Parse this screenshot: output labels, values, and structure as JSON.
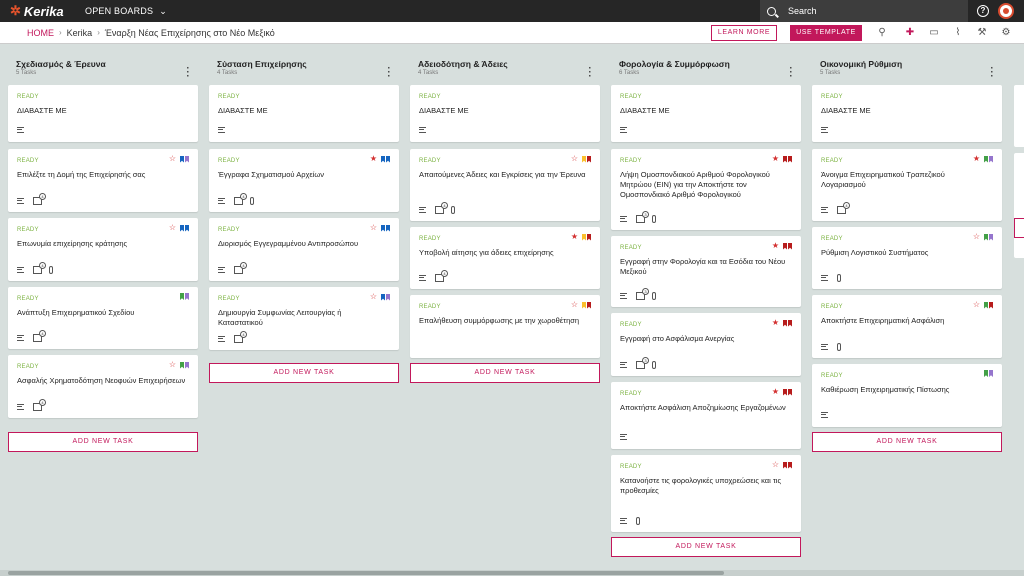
{
  "app": {
    "name": "Kerika",
    "open_boards": "OPEN BOARDS"
  },
  "search": {
    "placeholder": "Search"
  },
  "breadcrumb": {
    "home": "HOME",
    "org": "Kerika",
    "board": "Έναρξη Νέας Επιχείρησης στο Νέο Μεξικό"
  },
  "buttons": {
    "learn_more": "LEARN MORE",
    "use_template": "USE TEMPLATE",
    "add_task": "ADD NEW TASK"
  },
  "colors": {
    "accent": "#c2185b",
    "ready": "#7cb342",
    "star_red": "#d32f2f",
    "flag_blue": "#1565c0",
    "flag_purple": "#9575cd",
    "flag_green": "#43a047",
    "flag_yellow": "#fbc02d",
    "flag_darkred": "#b71c1c"
  },
  "columns": [
    {
      "title": "Σχεδιασμός & Έρευνα",
      "count": "5 Tasks",
      "cards": [
        {
          "status": "READY",
          "title": "ΔΙΑΒΑΣΤΕ ΜΕ",
          "flags": [],
          "icons": [
            "lines"
          ]
        },
        {
          "status": "READY",
          "title": "Επιλέξτε τη Δομή της Επιχείρησής σας",
          "star": "outline",
          "flags": [
            "blue",
            "purple"
          ],
          "icons": [
            "lines",
            "check"
          ],
          "checks": "4"
        },
        {
          "status": "READY",
          "title": "Επωνυμία επιχείρησης κράτησης",
          "star": "outline",
          "flags": [
            "blue",
            "blue"
          ],
          "icons": [
            "lines",
            "check",
            "clip"
          ],
          "checks": "4"
        },
        {
          "status": "READY",
          "title": "Ανάπτυξη Επιχειρηματικού Σχεδίου",
          "flags": [
            "green",
            "purple"
          ],
          "icons": [
            "lines",
            "check"
          ],
          "checks": "4"
        },
        {
          "status": "READY",
          "title": "Ασφαλής Χρηματοδότηση Νεοφυών Επιχειρήσεων",
          "star": "outline",
          "flags": [
            "green",
            "purple"
          ],
          "icons": [
            "lines",
            "check"
          ],
          "checks": "4"
        }
      ]
    },
    {
      "title": "Σύσταση Επιχείρησης",
      "count": "4 Tasks",
      "cards": [
        {
          "status": "READY",
          "title": "ΔΙΑΒΑΣΤΕ ΜΕ",
          "flags": [],
          "icons": [
            "lines"
          ]
        },
        {
          "status": "READY",
          "title": "Έγγραφα Σχηματισμού Αρχείων",
          "star": "filled",
          "flags": [
            "blue",
            "blue"
          ],
          "icons": [
            "lines",
            "check",
            "clip"
          ],
          "checks": "4"
        },
        {
          "status": "READY",
          "title": "Διορισμός Εγγεγραμμένου Αντιπροσώπου",
          "star": "outline",
          "flags": [
            "blue",
            "blue"
          ],
          "icons": [
            "lines",
            "check"
          ],
          "checks": "4"
        },
        {
          "status": "READY",
          "title": "Δημιουργία Συμφωνίας Λειτουργίας ή Καταστατικού",
          "star": "outline",
          "flags": [
            "blue",
            "purple"
          ],
          "icons": [
            "lines",
            "check"
          ],
          "checks": "4"
        }
      ]
    },
    {
      "title": "Αδειοδότηση & Άδειες",
      "count": "4 Tasks",
      "cards": [
        {
          "status": "READY",
          "title": "ΔΙΑΒΑΣΤΕ ΜΕ",
          "flags": [],
          "icons": [
            "lines"
          ]
        },
        {
          "status": "READY",
          "title": "Απαιτούμενες Άδειες και Εγκρίσεις για την Έρευνα",
          "star": "outline",
          "flags": [
            "yellow",
            "darkred"
          ],
          "icons": [
            "lines",
            "check",
            "clip"
          ],
          "checks": "4"
        },
        {
          "status": "READY",
          "title": "Υποβολή αίτησης για άδειες επιχείρησης",
          "star": "filled",
          "flags": [
            "yellow",
            "darkred"
          ],
          "icons": [
            "lines",
            "check"
          ],
          "checks": "4"
        },
        {
          "status": "READY",
          "title": "Επαλήθευση συμμόρφωσης με την χωροθέτηση",
          "star": "outline",
          "flags": [
            "yellow",
            "darkred"
          ],
          "icons": []
        }
      ]
    },
    {
      "title": "Φορολογία & Συμμόρφωση",
      "count": "6 Tasks",
      "cards": [
        {
          "status": "READY",
          "title": "ΔΙΑΒΑΣΤΕ ΜΕ",
          "flags": [],
          "icons": [
            "lines"
          ]
        },
        {
          "status": "READY",
          "title": "Λήψη Ομοσπονδιακού Αριθμού Φορολογικού Μητρώου (EIN) για την Αποκτήστε τον Ομοσπονδιακό Αριθμό Φορολογικού",
          "star": "filled",
          "flags": [
            "darkred",
            "darkred"
          ],
          "icons": [
            "lines",
            "check",
            "clip"
          ],
          "checks": "3"
        },
        {
          "status": "READY",
          "title": "Εγγραφή στην Φορολογία και τα Εσόδια του Νέου Μεξικού",
          "star": "filled",
          "flags": [
            "darkred",
            "darkred"
          ],
          "icons": [
            "lines",
            "check",
            "clip"
          ],
          "checks": "3"
        },
        {
          "status": "READY",
          "title": "Εγγραφή στο Ασφάλισμα Ανεργίας",
          "star": "filled",
          "flags": [
            "darkred",
            "darkred"
          ],
          "icons": [
            "lines",
            "check",
            "clip"
          ],
          "checks": "3"
        },
        {
          "status": "READY",
          "title": "Αποκτήστε Ασφάλιση Αποζημίωσης Εργαζομένων",
          "star": "filled",
          "flags": [
            "darkred",
            "darkred"
          ],
          "icons": [
            "lines"
          ]
        },
        {
          "status": "READY",
          "title": "Κατανοήστε τις φορολογικές υποχρεώσεις και τις προθεσμίες",
          "star": "outline",
          "flags": [
            "darkred",
            "darkred"
          ],
          "icons": [
            "lines",
            "clip"
          ]
        }
      ]
    },
    {
      "title": "Οικονομική Ρύθμιση",
      "count": "5 Tasks",
      "cards": [
        {
          "status": "READY",
          "title": "ΔΙΑΒΑΣΤΕ ΜΕ",
          "flags": [],
          "icons": [
            "lines"
          ]
        },
        {
          "status": "READY",
          "title": "Άνοιγμα Επιχειρηματικού Τραπεζικού Λογαριασμού",
          "star": "filled",
          "flags": [
            "green",
            "purple"
          ],
          "icons": [
            "lines",
            "check"
          ],
          "checks": "4"
        },
        {
          "status": "READY",
          "title": "Ρύθμιση Λογιστικού Συστήματος",
          "star": "outline",
          "flags": [
            "green",
            "purple"
          ],
          "icons": [
            "lines",
            "clip"
          ]
        },
        {
          "status": "READY",
          "title": "Αποκτήστε Επιχειρηματική Ασφάλιση",
          "star": "outline",
          "flags": [
            "green",
            "darkred"
          ],
          "icons": [
            "lines",
            "clip"
          ]
        },
        {
          "status": "READY",
          "title": "Καθιέρωση Επιχειρηματικής Πίστωσης",
          "flags": [
            "green",
            "purple"
          ],
          "icons": [
            "lines"
          ]
        }
      ]
    }
  ]
}
